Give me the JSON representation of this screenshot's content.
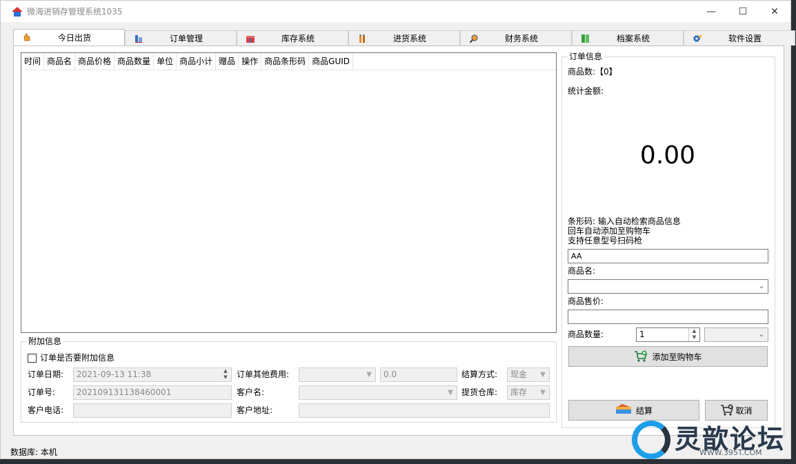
{
  "window": {
    "title": "微海进销存管理系统1035",
    "minimize": "—",
    "maximize": "☐",
    "close": "✕"
  },
  "tabs": [
    {
      "label": "今日出货",
      "icon": "hand-icon"
    },
    {
      "label": "订单管理",
      "icon": "order-icon"
    },
    {
      "label": "库存系统",
      "icon": "gift-icon"
    },
    {
      "label": "进货系统",
      "icon": "bottles-icon"
    },
    {
      "label": "财务系统",
      "icon": "search-icon"
    },
    {
      "label": "档案系统",
      "icon": "archive-icon"
    },
    {
      "label": "软件设置",
      "icon": "settings-icon"
    }
  ],
  "grid": {
    "columns": [
      "时间",
      "商品名",
      "商品价格",
      "商品数量",
      "单位",
      "商品小计",
      "赠品",
      "操作",
      "商品条形码",
      "商品GUID"
    ]
  },
  "extra": {
    "legend": "附加信息",
    "checkbox_label": "订单是否要附加信息",
    "order_date_label": "订单日期:",
    "order_date_value": "2021-09-13  11:38",
    "other_fee_label": "订单其他费用:",
    "other_fee_value": "0.0",
    "payment_label": "结算方式:",
    "payment_value": "现金",
    "order_no_label": "订单号:",
    "order_no_value": "202109131138460001",
    "customer_label": "客户名:",
    "warehouse_label": "提货仓库:",
    "warehouse_value": "库存",
    "phone_label": "客户电话:",
    "address_label": "客户地址:"
  },
  "order": {
    "legend": "订单信息",
    "count_text": "商品数:【0】",
    "total_label": "统计金额:",
    "total_value": "0.00",
    "barcode_hint1": "条形码: 输入自动检索商品信息",
    "barcode_hint2": "回车自动添加至购物车",
    "barcode_hint3": "支持任意型号扫码枪",
    "barcode_value": "AA",
    "name_label": "商品名:",
    "price_label": "商品售价:",
    "qty_label": "商品数量:",
    "qty_value": "1",
    "add_button": "添加至购物车",
    "checkout_button": "结算",
    "cancel_button": "取消"
  },
  "status": {
    "db": "数据库: 本机"
  },
  "watermark": {
    "brand": "灵歆论坛",
    "url": "WWW.395T.COM"
  },
  "colors": {
    "accent": "#1e9ee8"
  }
}
